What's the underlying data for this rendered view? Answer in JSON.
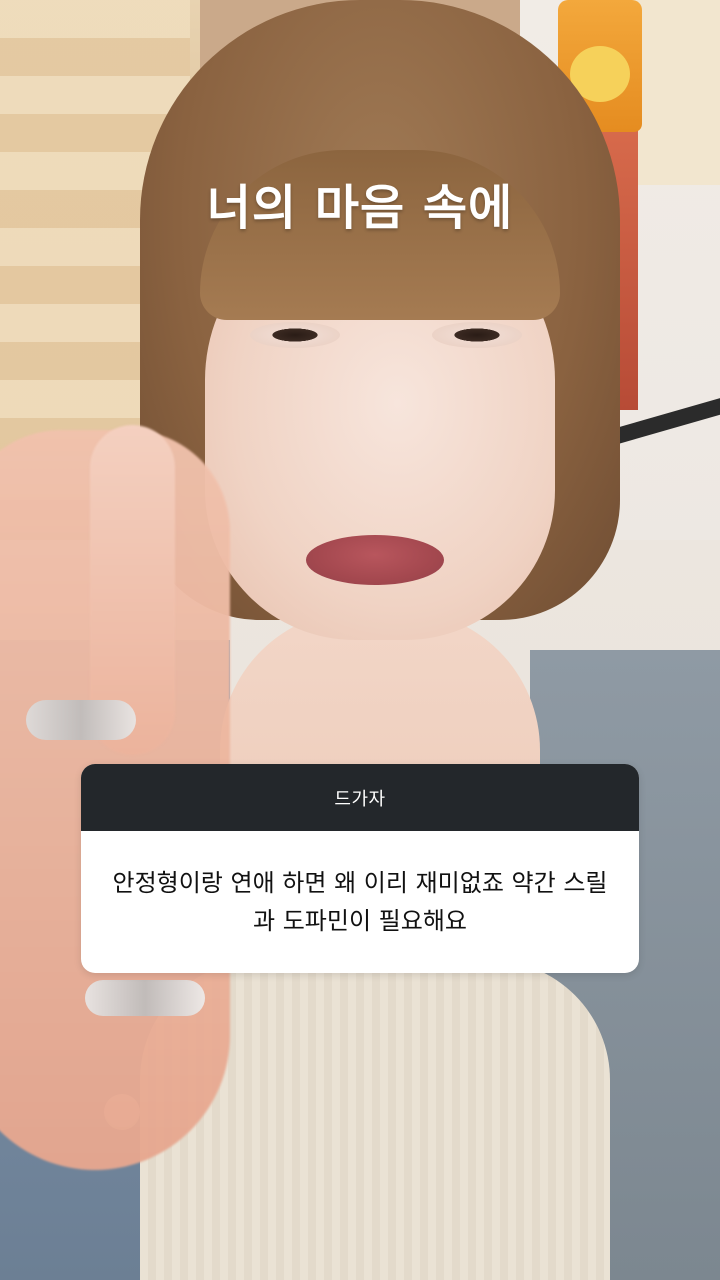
{
  "overlay": {
    "caption": "너의 마음 속에"
  },
  "question_sticker": {
    "header": "드가자",
    "question": "안정형이랑 연애 하면 왜 이리 재미없죠 약간 스릴과 도파민이 필요해요"
  },
  "colors": {
    "header_bg": "#23272b",
    "card_bg": "#ffffff",
    "caption_text": "#ffffff"
  }
}
